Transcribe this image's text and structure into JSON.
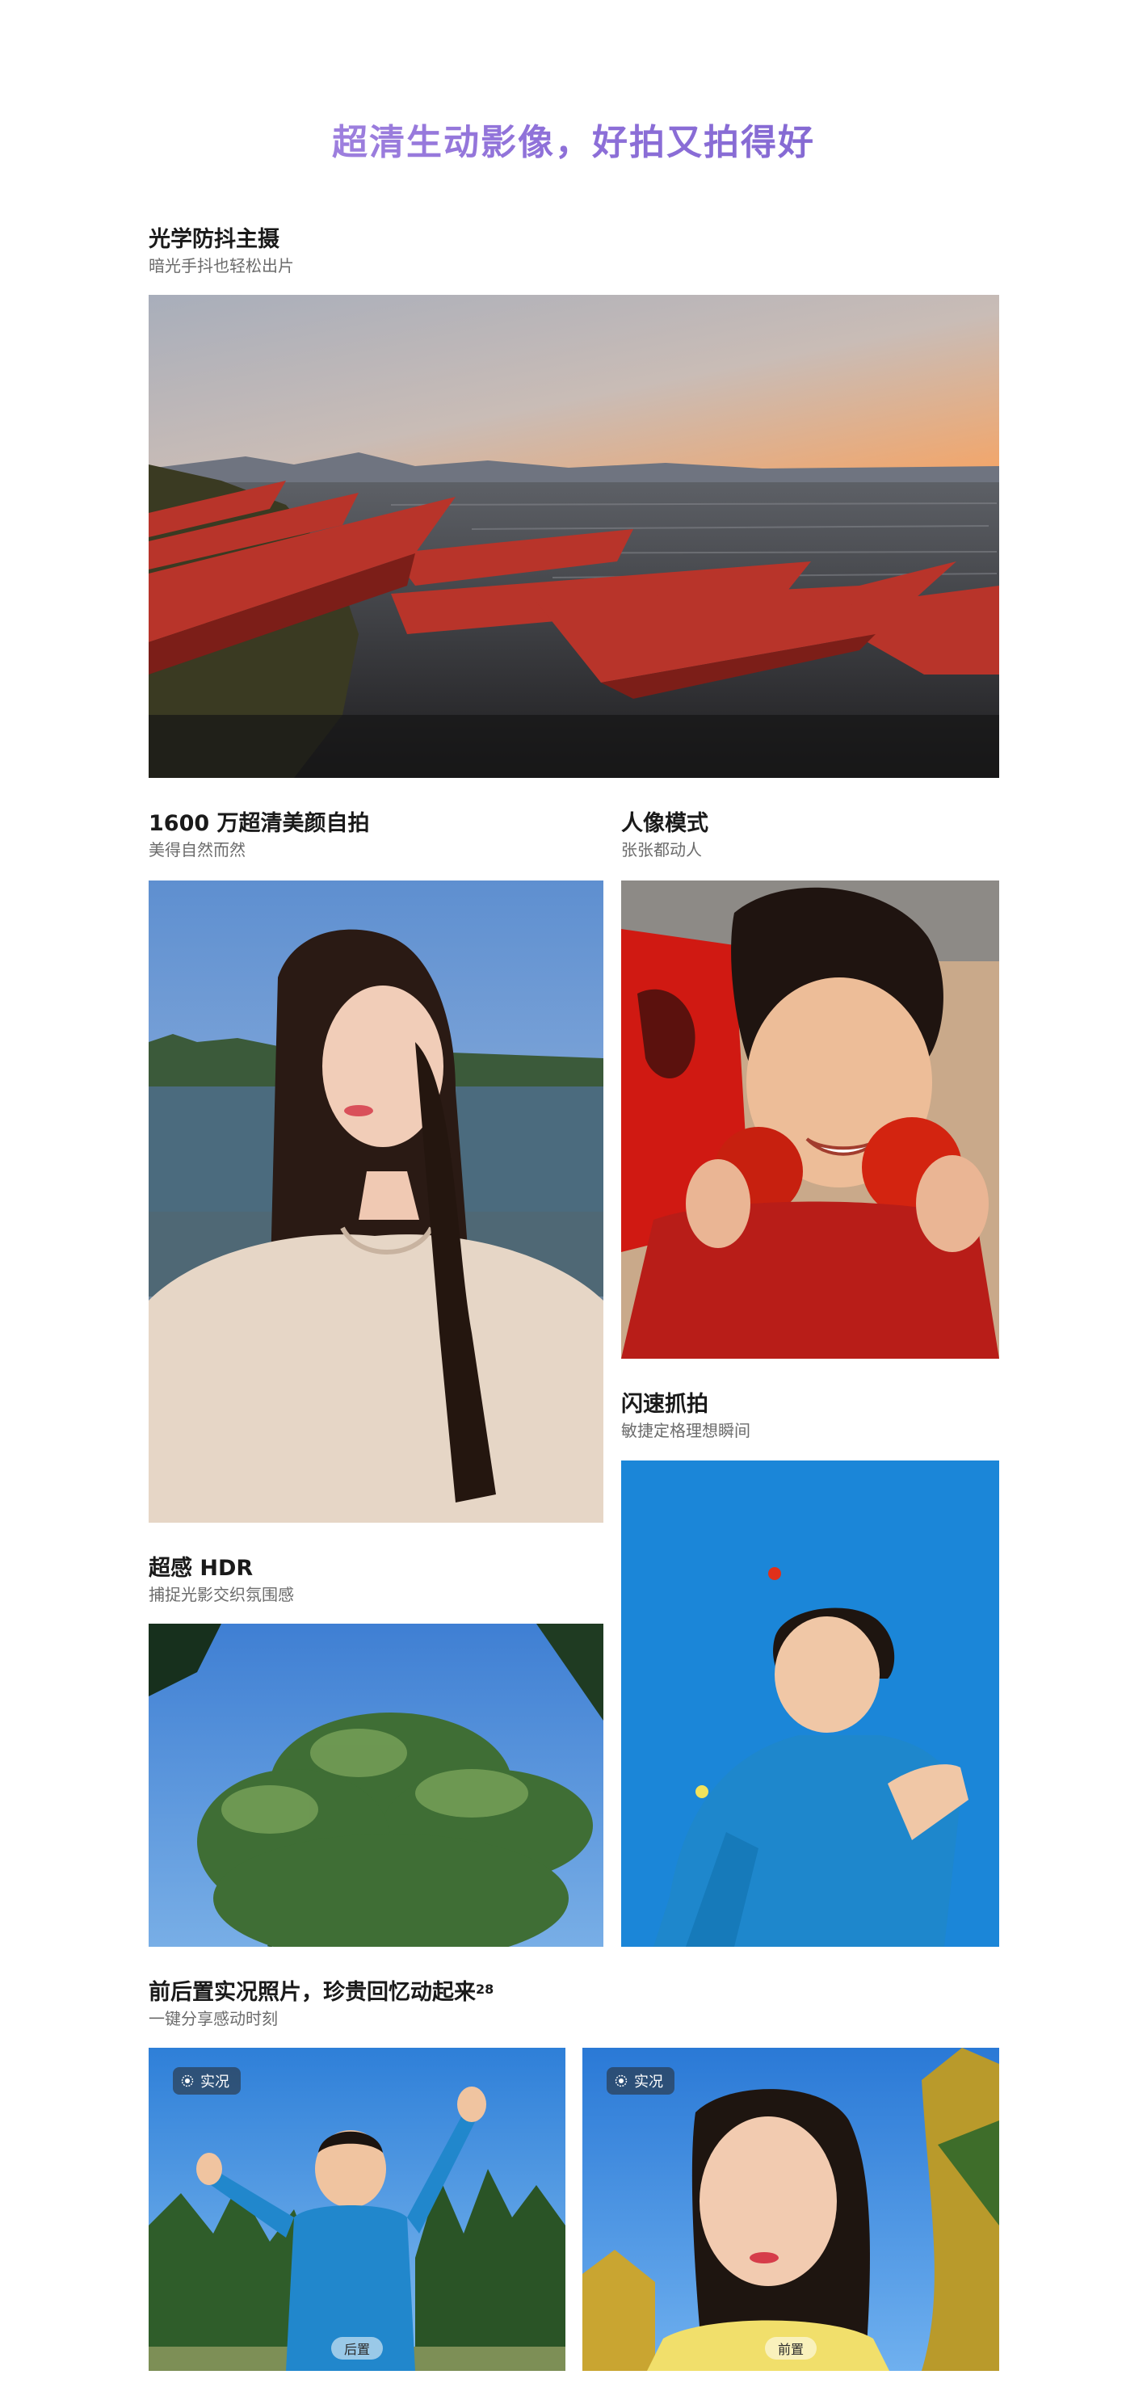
{
  "page": {
    "title": "超清生动影像，好拍又拍得好"
  },
  "sections": {
    "ois": {
      "title": "光学防抖主摄",
      "subtitle": "暗光手抖也轻松出片"
    },
    "selfie": {
      "title": "1600 万超清美颜自拍",
      "subtitle": "美得自然而然"
    },
    "portrait": {
      "title": "人像模式",
      "subtitle": "张张都动人"
    },
    "snap": {
      "title": "闪速抓拍",
      "subtitle": "敏捷定格理想瞬间"
    },
    "hdr": {
      "title": "超感 HDR",
      "subtitle": "捕捉光影交织氛围感"
    },
    "live": {
      "title": "前后置实况照片，珍贵回忆动起来",
      "footnote": "28",
      "subtitle": "一键分享感动时刻"
    }
  },
  "live_photos": [
    {
      "badge": "实况",
      "camera": "后置",
      "badge_icon": "live-photo-icon"
    },
    {
      "badge": "实况",
      "camera": "前置",
      "badge_icon": "live-photo-icon"
    }
  ],
  "colors": {
    "title_gradient_start": "#b496e6",
    "title_gradient_end": "#7a62cc",
    "subtitle": "#6b6b6b"
  }
}
